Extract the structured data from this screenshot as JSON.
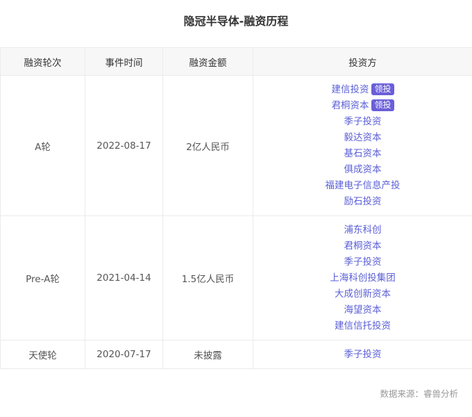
{
  "page": {
    "title": "隐冠半导体-融资历程"
  },
  "table": {
    "headers": [
      "融资轮次",
      "事件时间",
      "融资金额",
      "投资方"
    ],
    "lead_badge_text": "领投",
    "rows": [
      {
        "round": "A轮",
        "date": "2022-08-17",
        "amount": "2亿人民币",
        "investors": [
          {
            "name": "建信投资",
            "lead": true
          },
          {
            "name": "君桐资本",
            "lead": true
          },
          {
            "name": "季子投资",
            "lead": false
          },
          {
            "name": "毅达资本",
            "lead": false
          },
          {
            "name": "基石资本",
            "lead": false
          },
          {
            "name": "俱成资本",
            "lead": false
          },
          {
            "name": "福建电子信息产投",
            "lead": false
          },
          {
            "name": "励石投资",
            "lead": false
          }
        ]
      },
      {
        "round": "Pre-A轮",
        "date": "2021-04-14",
        "amount": "1.5亿人民币",
        "investors": [
          {
            "name": "浦东科创",
            "lead": false
          },
          {
            "name": "君桐资本",
            "lead": false
          },
          {
            "name": "季子投资",
            "lead": false
          },
          {
            "name": "上海科创投集团",
            "lead": false
          },
          {
            "name": "大成创新资本",
            "lead": false
          },
          {
            "name": "海望资本",
            "lead": false
          },
          {
            "name": "建信信托投资",
            "lead": false
          }
        ]
      },
      {
        "round": "天使轮",
        "date": "2020-07-17",
        "amount": "未披露",
        "investors": [
          {
            "name": "季子投资",
            "lead": false
          }
        ]
      }
    ]
  },
  "footer": {
    "source": "数据来源：睿兽分析"
  },
  "colors": {
    "investor_link": "#5b5fd6",
    "lead_badge": "#6a5fd8",
    "header_bg": "#f7f7f7",
    "border": "#ebebeb"
  }
}
